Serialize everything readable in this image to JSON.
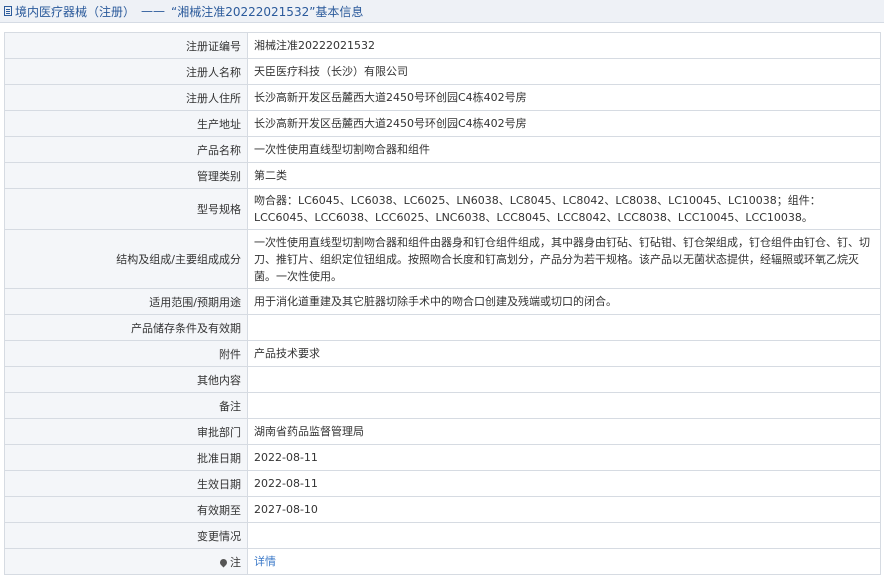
{
  "header": {
    "category": "境内医疗器械（注册）",
    "separator": "——",
    "record": "“湘械注准20222021532”基本信息"
  },
  "rows": [
    {
      "label": "注册证编号",
      "value": "湘械注准20222021532"
    },
    {
      "label": "注册人名称",
      "value": "天臣医疗科技（长沙）有限公司"
    },
    {
      "label": "注册人住所",
      "value": "长沙高新开发区岳麓西大道2450号环创园C4栋402号房"
    },
    {
      "label": "生产地址",
      "value": "长沙高新开发区岳麓西大道2450号环创园C4栋402号房"
    },
    {
      "label": "产品名称",
      "value": "一次性使用直线型切割吻合器和组件"
    },
    {
      "label": "管理类别",
      "value": "第二类"
    },
    {
      "label": "型号规格",
      "value": "吻合器：LC6045、LC6038、LC6025、LN6038、LC8045、LC8042、LC8038、LC10045、LC10038；组件：LCC6045、LCC6038、LCC6025、LNC6038、LCC8045、LCC8042、LCC8038、LCC10045、LCC10038。"
    },
    {
      "label": "结构及组成/主要组成成分",
      "value": "一次性使用直线型切割吻合器和组件由器身和钉仓组件组成，其中器身由钉砧、钉砧钳、钉仓架组成，钉仓组件由钉仓、钉、切刀、推钉片、组织定位钮组成。按照吻合长度和钉高划分，产品分为若干规格。该产品以无菌状态提供，经辐照或环氧乙烷灭菌。一次性使用。"
    },
    {
      "label": "适用范围/预期用途",
      "value": "用于消化道重建及其它脏器切除手术中的吻合口创建及残端或切口的闭合。"
    },
    {
      "label": "产品储存条件及有效期",
      "value": ""
    },
    {
      "label": "附件",
      "value": "产品技术要求"
    },
    {
      "label": "其他内容",
      "value": ""
    },
    {
      "label": "备注",
      "value": ""
    },
    {
      "label": "审批部门",
      "value": "湖南省药品监督管理局"
    },
    {
      "label": "批准日期",
      "value": "2022-08-11"
    },
    {
      "label": "生效日期",
      "value": "2022-08-11"
    },
    {
      "label": "有效期至",
      "value": "2027-08-10"
    },
    {
      "label": "变更情况",
      "value": ""
    }
  ],
  "note_row": {
    "label": "注",
    "link": "详情",
    "icon": "map-pin-icon"
  }
}
